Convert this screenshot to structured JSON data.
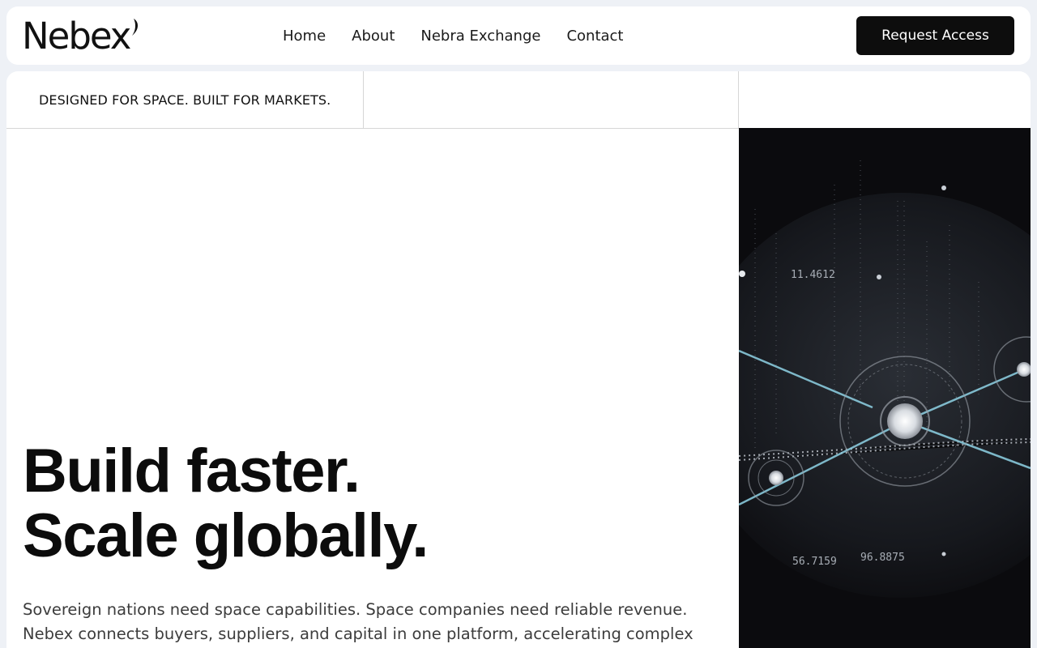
{
  "brand": {
    "name": "Nebex"
  },
  "nav": {
    "items": [
      {
        "label": "Home"
      },
      {
        "label": "About"
      },
      {
        "label": "Nebra Exchange"
      },
      {
        "label": "Contact"
      }
    ],
    "cta_label": "Request Access"
  },
  "strip": {
    "tagline": "DESIGNED FOR SPACE. BUILT FOR MARKETS."
  },
  "hero": {
    "headline_line1": "Build faster.",
    "headline_line2": "Scale globally.",
    "lede": "Sovereign nations need space capabilities. Space companies need reliable revenue. Nebex connects buyers, suppliers, and capital in one platform, accelerating complex"
  },
  "visual": {
    "readouts": [
      "11.4612",
      "56.7159",
      "96.8875"
    ]
  },
  "colors": {
    "page_bg": "#eef1f6",
    "panel_bg": "#ffffff",
    "cta_bg": "#0d0d0d",
    "visual_bg": "#0b0b0e",
    "accent_line": "#8fd3e6"
  }
}
